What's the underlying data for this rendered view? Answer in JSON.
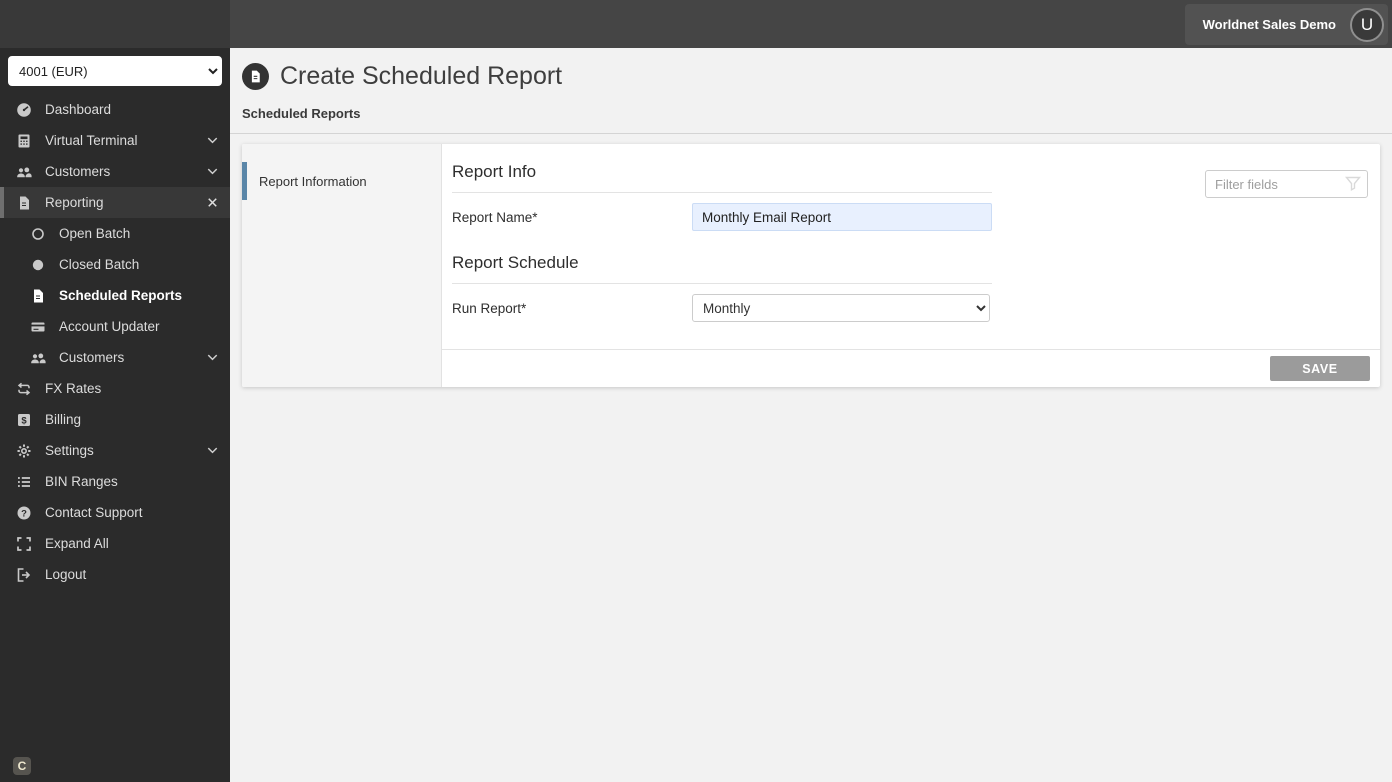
{
  "topbar": {
    "user_label": "Worldnet Sales Demo",
    "avatar_initial": "U"
  },
  "sidebar": {
    "terminal_select": {
      "value": "4001 (EUR)"
    },
    "items": [
      {
        "label": "Dashboard",
        "icon": "dashboard-icon"
      },
      {
        "label": "Virtual Terminal",
        "icon": "calculator-icon",
        "expandable": true
      },
      {
        "label": "Customers",
        "icon": "people-icon",
        "expandable": true
      },
      {
        "label": "Reporting",
        "icon": "document-icon",
        "active": true,
        "closable": true
      },
      {
        "label": "Open Batch",
        "icon": "circle-outline-icon",
        "sub": true
      },
      {
        "label": "Closed Batch",
        "icon": "circle-filled-icon",
        "sub": true
      },
      {
        "label": "Scheduled Reports",
        "icon": "document-icon",
        "sub": true,
        "selected": true
      },
      {
        "label": "Account Updater",
        "icon": "card-icon",
        "sub": true
      },
      {
        "label": "Customers",
        "icon": "people-icon",
        "sub": true,
        "expandable": true
      },
      {
        "label": "FX Rates",
        "icon": "repeat-icon"
      },
      {
        "label": "Billing",
        "icon": "billing-icon"
      },
      {
        "label": "Settings",
        "icon": "gear-icon",
        "expandable": true
      },
      {
        "label": "BIN Ranges",
        "icon": "list-icon"
      },
      {
        "label": "Contact Support",
        "icon": "help-icon"
      },
      {
        "label": "Expand All",
        "icon": "expand-icon"
      },
      {
        "label": "Logout",
        "icon": "logout-icon"
      }
    ],
    "logo_initial": "C"
  },
  "header": {
    "title": "Create Scheduled Report",
    "breadcrumb": "Scheduled Reports"
  },
  "panel": {
    "nav": {
      "active_item": "Report Information"
    },
    "filter": {
      "placeholder": "Filter fields"
    },
    "sections": [
      {
        "heading": "Report Info",
        "fields": [
          {
            "label": "Report Name*",
            "value": "Monthly Email Report",
            "type": "text"
          }
        ]
      },
      {
        "heading": "Report Schedule",
        "fields": [
          {
            "label": "Run Report*",
            "value": "Monthly",
            "type": "select"
          }
        ]
      }
    ],
    "save_label": "SAVE"
  },
  "colors": {
    "accent_blue": "#5a86a8",
    "autofill_bg": "#e8f0fe",
    "save_bg": "#9b9b9b",
    "sidebar_bg": "#2b2b2b",
    "topbar_bg": "#454545"
  }
}
